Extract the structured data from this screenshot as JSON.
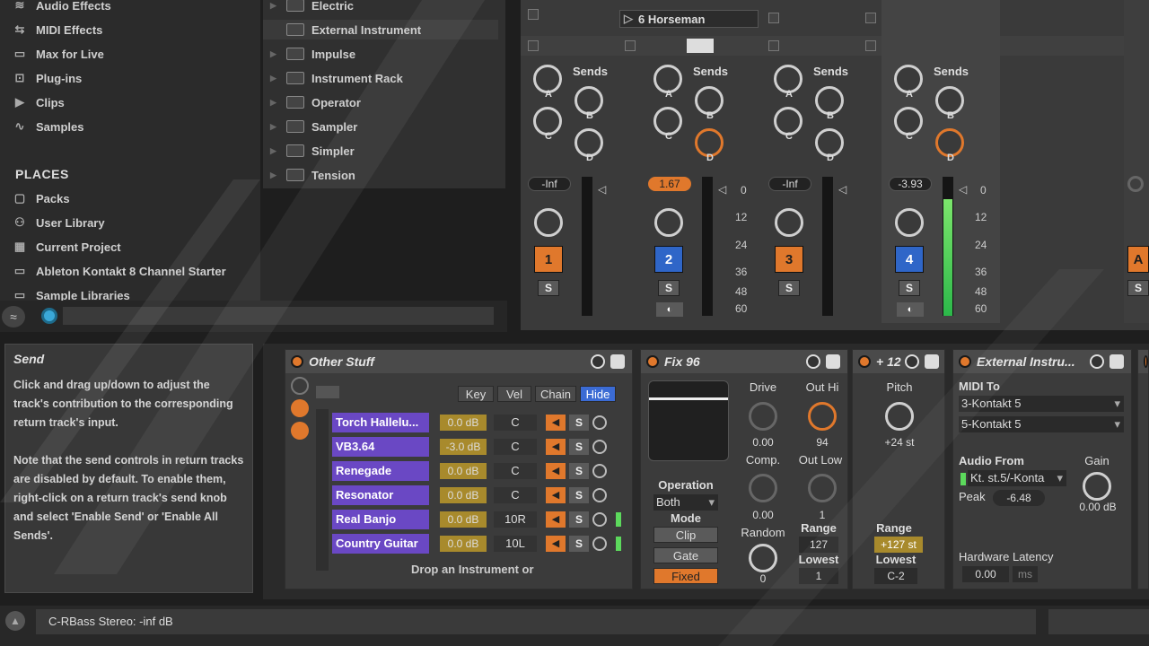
{
  "browser": {
    "categories": [
      {
        "label": "Audio Effects",
        "icon": "audio-effects-icon"
      },
      {
        "label": "MIDI Effects",
        "icon": "midi-effects-icon"
      },
      {
        "label": "Max for Live",
        "icon": "max-for-live-icon"
      },
      {
        "label": "Plug-ins",
        "icon": "plugins-icon"
      },
      {
        "label": "Clips",
        "icon": "clips-icon"
      },
      {
        "label": "Samples",
        "icon": "samples-icon"
      }
    ],
    "places_title": "PLACES",
    "places": [
      {
        "label": "Packs",
        "icon": "packs-icon"
      },
      {
        "label": "User Library",
        "icon": "user-library-icon"
      },
      {
        "label": "Current Project",
        "icon": "current-project-icon"
      },
      {
        "label": "Ableton Kontakt 8 Channel Starter",
        "icon": "folder-icon"
      },
      {
        "label": "Sample Libraries",
        "icon": "folder-icon"
      }
    ],
    "devices": [
      "Electric",
      "External Instrument",
      "Impulse",
      "Instrument Rack",
      "Operator",
      "Sampler",
      "Simpler",
      "Tension"
    ]
  },
  "mixer": {
    "clip_name": "6 Horseman",
    "sends_label": "Sends",
    "send_letters": [
      "A",
      "B",
      "C",
      "D"
    ],
    "tracks": [
      {
        "number": "1",
        "volume": "-Inf",
        "color": "orange",
        "solo": "S"
      },
      {
        "number": "2",
        "volume": "1.67",
        "color": "blue",
        "solo": "S"
      },
      {
        "number": "3",
        "volume": "-Inf",
        "color": "orange",
        "solo": "S"
      },
      {
        "number": "4",
        "volume": "-3.93",
        "color": "blue",
        "solo": "S"
      }
    ],
    "partial_track": {
      "number": "A",
      "solo": "S"
    },
    "meter_scale": [
      "0",
      "12",
      "24",
      "36",
      "48",
      "60"
    ]
  },
  "info": {
    "title": "Send",
    "body_p1": "Click and drag up/down to adjust the track's contribution to the corresponding return track's input.",
    "body_p2": "Note that the send controls in return tracks are disabled by default. To enable them, right-click on a return track's send knob and select 'Enable Send' or 'Enable All Sends'."
  },
  "rack": {
    "title": "Other Stuff",
    "columns": [
      "Key",
      "Vel",
      "Chain",
      "Hide"
    ],
    "chains": [
      {
        "name": "Torch Hallelu...",
        "vol": "0.0 dB",
        "pan": "C",
        "solo": "S"
      },
      {
        "name": "VB3.64",
        "vol": "-3.0 dB",
        "pan": "C",
        "solo": "S"
      },
      {
        "name": "Renegade",
        "vol": "0.0 dB",
        "pan": "C",
        "solo": "S"
      },
      {
        "name": "Resonator",
        "vol": "0.0 dB",
        "pan": "C",
        "solo": "S"
      },
      {
        "name": "Real Banjo",
        "vol": "0.0 dB",
        "pan": "10R",
        "solo": "S"
      },
      {
        "name": "Country Guitar",
        "vol": "0.0 dB",
        "pan": "10L",
        "solo": "S"
      }
    ],
    "drop_text": "Drop an Instrument or"
  },
  "fix96": {
    "title": "Fix 96",
    "drive_label": "Drive",
    "drive_val": "0.00",
    "comp_label": "Comp.",
    "comp_val": "0.00",
    "outhi_label": "Out Hi",
    "outhi_val": "94",
    "outlow_label": "Out Low",
    "outlow_val": "1",
    "operation_label": "Operation",
    "operation_val": "Both",
    "mode_label": "Mode",
    "mode_buttons": [
      "Clip",
      "Gate",
      "Fixed"
    ],
    "random_label": "Random",
    "random_val": "0",
    "range_label": "Range",
    "range_val": "127",
    "lowest_label": "Lowest",
    "lowest_val": "1"
  },
  "pitch": {
    "title": "+ 12",
    "pitch_label": "Pitch",
    "pitch_val": "+24 st",
    "range_label": "Range",
    "range_val": "+127 st",
    "lowest_label": "Lowest",
    "lowest_val": "C-2"
  },
  "external": {
    "title": "External Instru...",
    "midi_to_label": "MIDI To",
    "midi_to_1": "3-Kontakt 5",
    "midi_to_2": "5-Kontakt 5",
    "audio_from_label": "Audio From",
    "audio_from_val": "Kt. st.5/-Konta",
    "gain_label": "Gain",
    "gain_val": "0.00 dB",
    "peak_label": "Peak",
    "peak_val": "-6.48",
    "latency_label": "Hardware Latency",
    "latency_val": "0.00",
    "latency_unit": "ms"
  },
  "status": {
    "text": "C-RBass Stereo: -inf dB"
  },
  "colors": {
    "accent": "#e0782c",
    "blue": "#2f66c8",
    "chain": "#6a48c4",
    "meter": "#5cd95c"
  }
}
